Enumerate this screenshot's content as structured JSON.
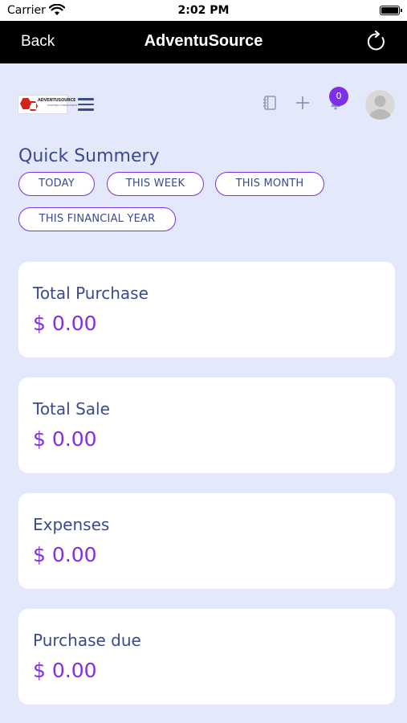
{
  "status_bar": {
    "carrier": "Carrier",
    "time": "2:02 PM"
  },
  "nav": {
    "back_label": "Back",
    "title": "AdventuSource"
  },
  "header": {
    "logo_text": "ADVENTUSOURCE",
    "logo_subtext": "STAFFING CONSULTANTS",
    "notification_count": "0"
  },
  "summary": {
    "title": "Quick Summery",
    "filters": [
      "TODAY",
      "THIS WEEK",
      "THIS MONTH",
      "THIS FINANCIAL YEAR"
    ]
  },
  "cards": [
    {
      "label": "Total Purchase",
      "value": "$ 0.00"
    },
    {
      "label": "Total Sale",
      "value": "$ 0.00"
    },
    {
      "label": "Expenses",
      "value": "$ 0.00"
    },
    {
      "label": "Purchase due",
      "value": "$ 0.00"
    }
  ],
  "colors": {
    "accent": "#7e2fe8",
    "text_primary": "#3b4a8c",
    "background": "#e3e9fb"
  }
}
